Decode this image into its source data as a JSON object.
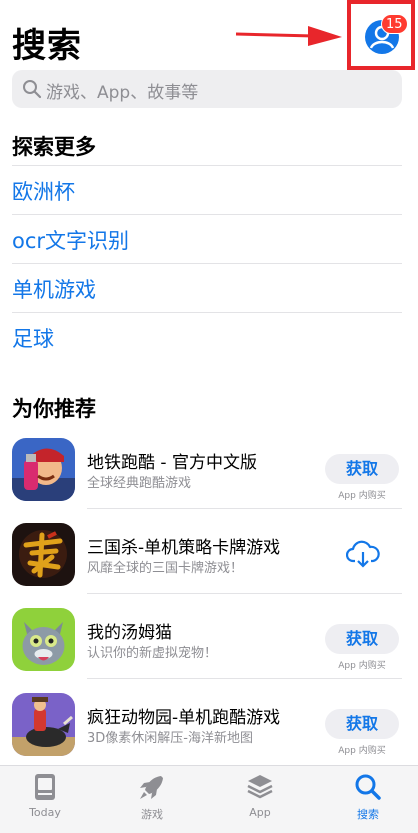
{
  "header": {
    "title": "搜索",
    "badge_count": "15"
  },
  "search": {
    "placeholder": "游戏、App、故事等"
  },
  "explore": {
    "title": "探索更多",
    "items": [
      "欧洲杯",
      "ocr文字识别",
      "单机游戏",
      "足球"
    ]
  },
  "recommend": {
    "title": "为你推荐",
    "apps": [
      {
        "name": "地铁跑酷 - 官方中文版",
        "subtitle": "全球经典跑酷游戏",
        "action": "获取",
        "iap": "App 内购买"
      },
      {
        "name": "三国杀-单机策略卡牌游戏",
        "subtitle": "风靡全球的三国卡牌游戏！",
        "action": "cloud-download-icon",
        "iap": ""
      },
      {
        "name": "我的汤姆猫",
        "subtitle": "认识你的新虚拟宠物！",
        "action": "获取",
        "iap": "App 内购买"
      },
      {
        "name": "疯狂动物园-单机跑酷游戏",
        "subtitle": "3D像素休闲解压-海洋新地图",
        "action": "获取",
        "iap": "App 内购买"
      }
    ]
  },
  "tabbar": {
    "items": [
      {
        "label": "Today",
        "icon": "today-icon"
      },
      {
        "label": "游戏",
        "icon": "rocket-icon"
      },
      {
        "label": "App",
        "icon": "layers-icon"
      },
      {
        "label": "搜索",
        "icon": "search-icon",
        "active": true
      }
    ]
  },
  "colors": {
    "accent": "#1377e8",
    "badge": "#ff3b30",
    "highlight": "#e8262b"
  }
}
